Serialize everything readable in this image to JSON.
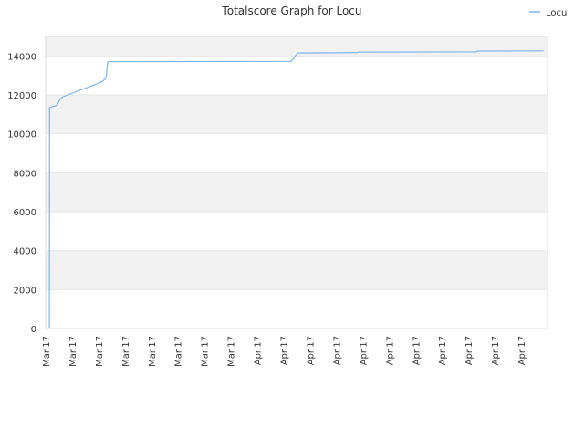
{
  "chart_data": {
    "type": "line",
    "title": "Totalscore Graph for Locu",
    "xlabel": "",
    "ylabel": "",
    "ylim": [
      0,
      15000
    ],
    "yticks": [
      0,
      2000,
      4000,
      6000,
      8000,
      10000,
      12000,
      14000
    ],
    "ytick_labels": [
      "0",
      "2000",
      "4000",
      "6000",
      "8000",
      "10000",
      "12000",
      "14000"
    ],
    "xtick_labels": [
      "Mar.17",
      "Mar.17",
      "Mar.17",
      "Mar.17",
      "Mar.17",
      "Mar.17",
      "Mar.17",
      "Mar.17",
      "Apr.17",
      "Apr.17",
      "Apr.17",
      "Apr.17",
      "Apr.17",
      "Apr.17",
      "Apr.17",
      "Apr.17",
      "Apr.17",
      "Apr.17",
      "Apr.17"
    ],
    "x_range": [
      0,
      19
    ],
    "grid": true,
    "legend": "top-right",
    "series": [
      {
        "name": "Locu",
        "color": "#7cb5ec",
        "points": [
          [
            0.14,
            0
          ],
          [
            0.15,
            11350
          ],
          [
            0.25,
            11400
          ],
          [
            0.35,
            11420
          ],
          [
            0.45,
            11500
          ],
          [
            0.55,
            11800
          ],
          [
            0.65,
            11900
          ],
          [
            2.0,
            12600
          ],
          [
            2.15,
            12700
          ],
          [
            2.25,
            12800
          ],
          [
            2.3,
            13000
          ],
          [
            2.35,
            13700
          ],
          [
            9.3,
            13720
          ],
          [
            9.45,
            14000
          ],
          [
            9.55,
            14150
          ],
          [
            11.8,
            14170
          ],
          [
            11.85,
            14200
          ],
          [
            16.3,
            14210
          ],
          [
            16.35,
            14250
          ],
          [
            18.85,
            14260
          ]
        ]
      }
    ]
  }
}
